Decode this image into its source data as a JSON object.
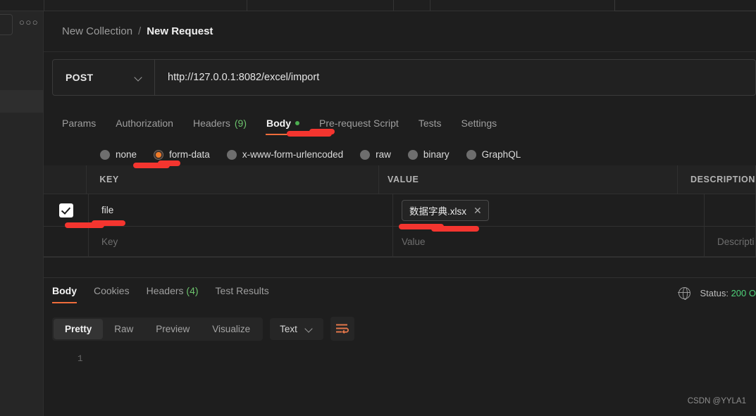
{
  "sidebar": {
    "more_icon": "ellipsis-icon"
  },
  "breadcrumb": {
    "collection": "New Collection",
    "separator": "/",
    "request": "New Request"
  },
  "url_bar": {
    "method": "POST",
    "method_chevron": "chevron-down-icon",
    "url": "http://127.0.0.1:8082/excel/import"
  },
  "request_tabs": [
    {
      "label": "Params",
      "active": false
    },
    {
      "label": "Authorization",
      "active": false
    },
    {
      "label": "Headers",
      "count": "(9)",
      "active": false
    },
    {
      "label": "Body",
      "active": true,
      "dot": true
    },
    {
      "label": "Pre-request Script",
      "active": false
    },
    {
      "label": "Tests",
      "active": false
    },
    {
      "label": "Settings",
      "active": false
    }
  ],
  "body_types": [
    {
      "label": "none",
      "selected": false
    },
    {
      "label": "form-data",
      "selected": true
    },
    {
      "label": "x-www-form-urlencoded",
      "selected": false
    },
    {
      "label": "raw",
      "selected": false
    },
    {
      "label": "binary",
      "selected": false
    },
    {
      "label": "GraphQL",
      "selected": false
    }
  ],
  "form_table": {
    "headers": {
      "key": "KEY",
      "value": "VALUE",
      "description": "DESCRIPTION"
    },
    "rows": [
      {
        "checked": true,
        "key": "file",
        "value_file": "数据字典.xlsx",
        "remove_icon": "close-icon",
        "description": ""
      }
    ],
    "placeholders": {
      "key": "Key",
      "value": "Value",
      "description": "Descripti"
    }
  },
  "response_tabs": [
    {
      "label": "Body",
      "active": true
    },
    {
      "label": "Cookies",
      "active": false
    },
    {
      "label": "Headers",
      "count": "(4)",
      "active": false
    },
    {
      "label": "Test Results",
      "active": false
    }
  ],
  "status": {
    "globe_icon": "globe-icon",
    "label": "Status: ",
    "code": "200 O"
  },
  "format_toolbar": {
    "views": [
      {
        "label": "Pretty",
        "active": true
      },
      {
        "label": "Raw",
        "active": false
      },
      {
        "label": "Preview",
        "active": false
      },
      {
        "label": "Visualize",
        "active": false
      }
    ],
    "language": "Text",
    "language_chevron": "chevron-down-icon",
    "wrap_icon": "word-wrap-icon"
  },
  "editor": {
    "line_number": "1",
    "content": ""
  },
  "watermark": "CSDN @YYLA1",
  "colors": {
    "accent": "#ef6c3b",
    "radio_selected": "#f07c29",
    "success": "#4fd27a",
    "annotation": "#f4352f",
    "background": "#1e1e1e"
  }
}
